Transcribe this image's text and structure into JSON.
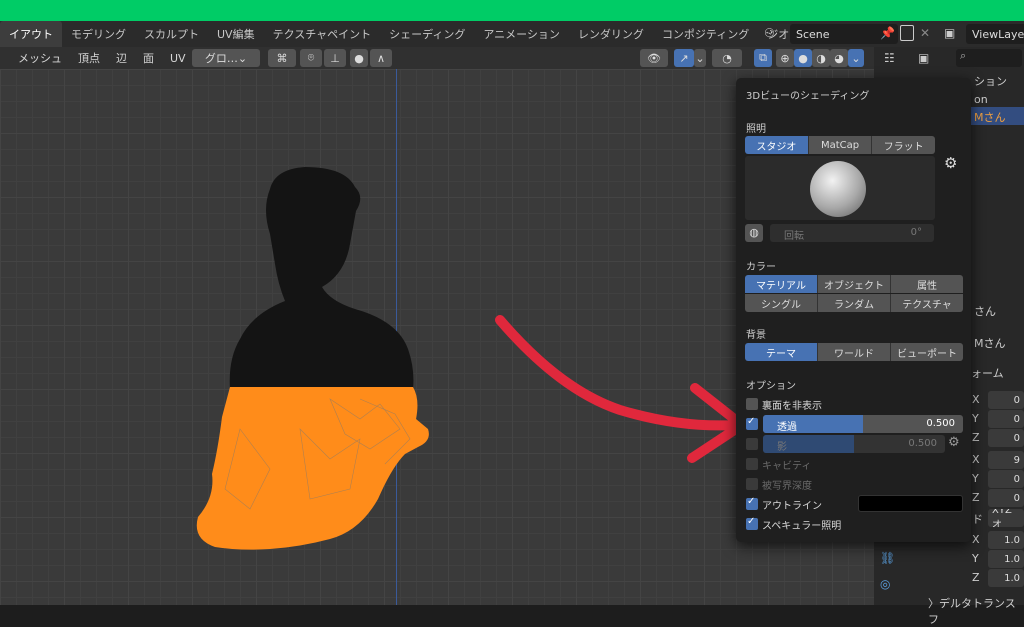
{
  "tabs": [
    "イアウト",
    "モデリング",
    "スカルプト",
    "UV編集",
    "テクスチャペイント",
    "シェーディング",
    "アニメーション",
    "レンダリング",
    "コンポジティング",
    "ジオメト"
  ],
  "scene": "Scene",
  "view_layer": "ViewLayer",
  "header_menu": [
    "メッシュ",
    "頂点",
    "辺",
    "面",
    "UV"
  ],
  "orientation": "グロ…",
  "popup": {
    "title": "3Dビューのシェーディング",
    "lighting_label": "照明",
    "lighting_options": [
      "スタジオ",
      "MatCap",
      "フラット"
    ],
    "rotation_label": "回転",
    "rotation_value": "0°",
    "color_label": "カラー",
    "color_options_row1": [
      "マテリアル",
      "オブジェクト",
      "属性"
    ],
    "color_options_row2": [
      "シングル",
      "ランダム",
      "テクスチャ"
    ],
    "background_label": "背景",
    "background_options": [
      "テーマ",
      "ワールド",
      "ビューポート"
    ],
    "options_label": "オプション",
    "backface": "裏面を非表示",
    "xray_label": "透過",
    "xray_value": "0.500",
    "xray_fraction": 0.5,
    "shadow_label": "影",
    "shadow_value": "0.500",
    "shadow_fraction": 0.5,
    "cavity": "キャビティ",
    "dof": "被写界深度",
    "outline": "アウトライン",
    "specular": "スペキュラー照明"
  },
  "right_panel": {
    "header_text": "ション",
    "row2": "on",
    "row3": "Mさん",
    "row4": "さん",
    "row5": "Mさん",
    "row6": "ォーム",
    "axes": [
      "X",
      "Y",
      "Z",
      "X",
      "Y",
      "Z",
      "X",
      "Y",
      "Z"
    ],
    "fields": [
      "0",
      "0",
      "0",
      "9",
      "0",
      "0",
      "1.0",
      "1.0",
      "1.0"
    ],
    "mode": "XYZ オ",
    "mode_label": "ド",
    "footer": "〉デルタトランスフ"
  },
  "colors": {
    "accent": "#4772b3",
    "arrow": "#e0283c",
    "mesh_orange": "#ff8c1a",
    "top_band": "#00cc66"
  }
}
